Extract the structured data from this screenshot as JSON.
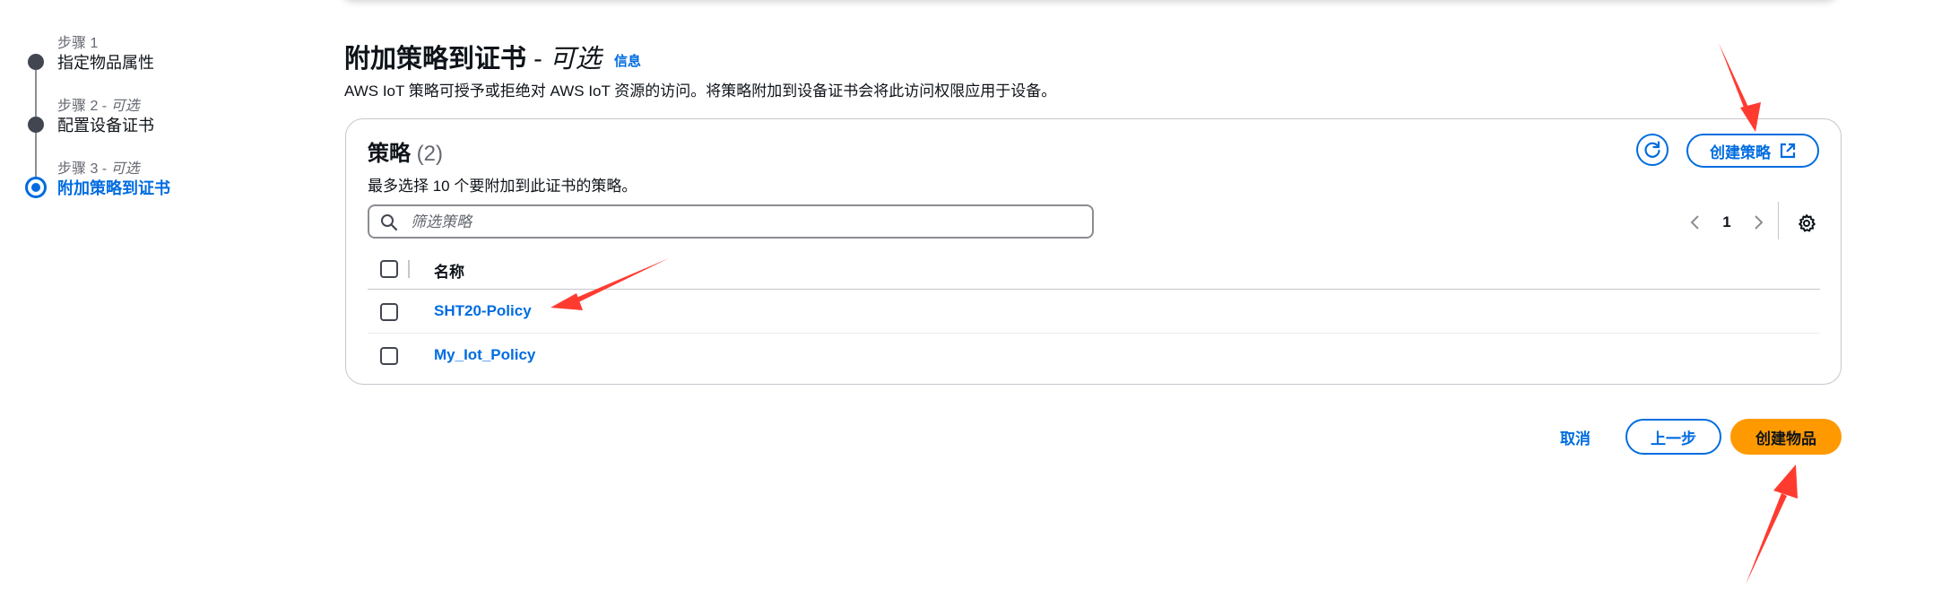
{
  "steps": [
    {
      "caption": "步骤 1",
      "optional": "",
      "title": "指定物品属性"
    },
    {
      "caption": "步骤 2 - ",
      "optional": "可选",
      "title": "配置设备证书"
    },
    {
      "caption": "步骤 3 - ",
      "optional": "可选",
      "title": "附加策略到证书"
    }
  ],
  "header": {
    "title": "附加策略到证书",
    "separator": " - ",
    "optional": "可选",
    "info": "信息",
    "description": "AWS IoT 策略可授予或拒绝对 AWS IoT 资源的访问。将策略附加到设备证书会将此访问权限应用于设备。"
  },
  "policies": {
    "title": "策略",
    "count": "(2)",
    "description": "最多选择 10 个要附加到此证书的策略。",
    "create_label": "创建策略",
    "search_placeholder": "筛选策略",
    "page": "1",
    "column_name": "名称",
    "rows": [
      {
        "name": "SHT20-Policy"
      },
      {
        "name": "My_Iot_Policy"
      }
    ]
  },
  "footer": {
    "cancel": "取消",
    "previous": "上一步",
    "create": "创建物品"
  },
  "colors": {
    "accent": "#006ce0",
    "primary_button": "#ff9900",
    "annotation_arrow": "#ff3b30"
  },
  "icons": [
    "refresh-icon",
    "external-link-icon",
    "search-icon",
    "chevron-left-icon",
    "chevron-right-icon",
    "gear-icon"
  ]
}
